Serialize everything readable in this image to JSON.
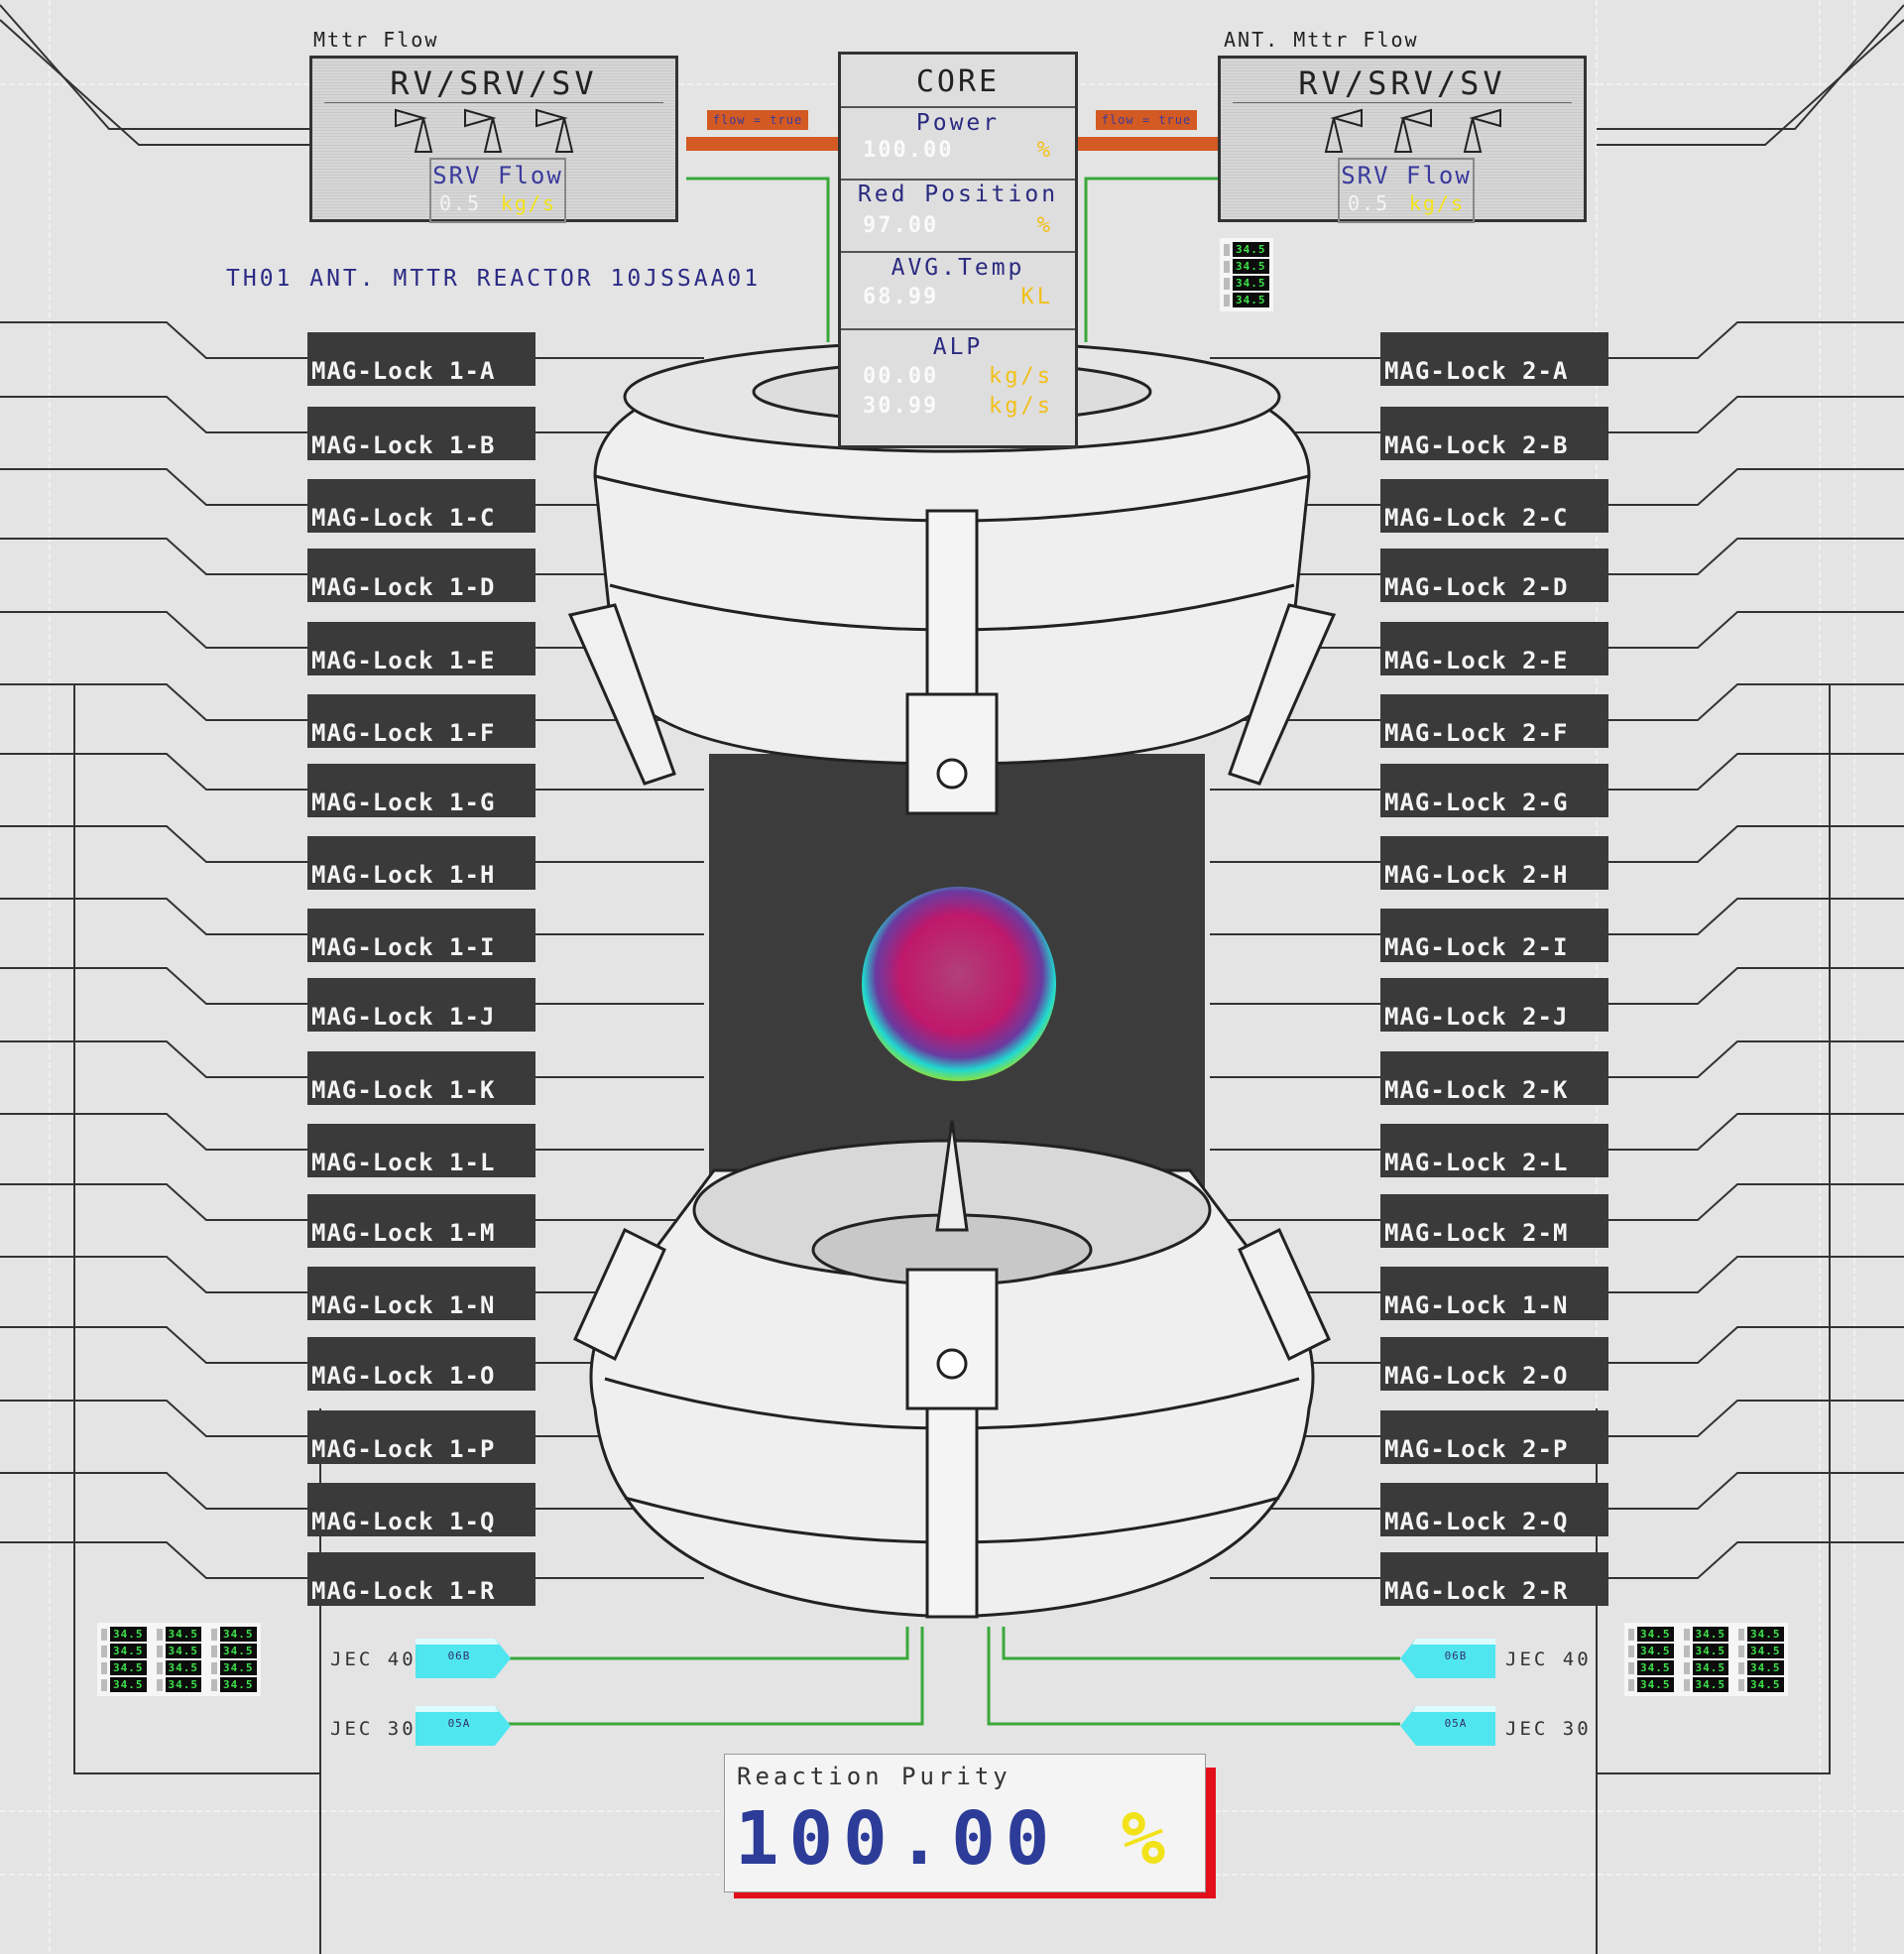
{
  "reactor_id": "TH01 ANT. MTTR REACTOR 10JSSAA01",
  "left_flow_panel": {
    "label": "Mttr Flow",
    "title": "RV/SRV/SV",
    "srv_title": "SRV Flow",
    "srv_value": "0.5",
    "srv_unit": "kg/s",
    "flow_tag": "flow = true"
  },
  "right_flow_panel": {
    "label": "ANT. Mttr Flow",
    "title": "RV/SRV/SV",
    "srv_title": "SRV Flow",
    "srv_value": "0.5",
    "srv_unit": "kg/s",
    "flow_tag": "flow = true"
  },
  "core": {
    "title": "CORE",
    "power": {
      "label": "Power",
      "value": "100.00",
      "unit": "%"
    },
    "red_position": {
      "label": "Red Position",
      "value": "97.00",
      "unit": "%"
    },
    "avg_temp": {
      "label": "AVG.Temp",
      "value": "68.99",
      "unit": "KL"
    },
    "alp": {
      "label": "ALP",
      "value1": "00.00",
      "unit1": "kg/s",
      "value2": "30.99",
      "unit2": "kg/s"
    }
  },
  "mag_locks_left": [
    "MAG-Lock 1-A",
    "MAG-Lock 1-B",
    "MAG-Lock 1-C",
    "MAG-Lock 1-D",
    "MAG-Lock 1-E",
    "MAG-Lock 1-F",
    "MAG-Lock 1-G",
    "MAG-Lock 1-H",
    "MAG-Lock 1-I",
    "MAG-Lock 1-J",
    "MAG-Lock 1-K",
    "MAG-Lock 1-L",
    "MAG-Lock 1-M",
    "MAG-Lock 1-N",
    "MAG-Lock 1-O",
    "MAG-Lock 1-P",
    "MAG-Lock 1-Q",
    "MAG-Lock 1-R"
  ],
  "mag_locks_right": [
    "MAG-Lock 2-A",
    "MAG-Lock 2-B",
    "MAG-Lock 2-C",
    "MAG-Lock 2-D",
    "MAG-Lock 2-E",
    "MAG-Lock 2-F",
    "MAG-Lock 2-G",
    "MAG-Lock 2-H",
    "MAG-Lock 2-I",
    "MAG-Lock 2-J",
    "MAG-Lock 2-K",
    "MAG-Lock 2-L",
    "MAG-Lock 2-M",
    "MAG-Lock 1-N",
    "MAG-Lock 2-O",
    "MAG-Lock 2-P",
    "MAG-Lock 2-Q",
    "MAG-Lock 2-R"
  ],
  "lcd_reading": "34.5",
  "jec_left": [
    {
      "label": "JEC 40",
      "tag": "06B"
    },
    {
      "label": "JEC 30",
      "tag": "05A"
    }
  ],
  "jec_right": [
    {
      "label": "JEC 40",
      "tag": "06B"
    },
    {
      "label": "JEC 30",
      "tag": "05A"
    }
  ],
  "reaction_purity": {
    "label": "Reaction Purity",
    "value": "100.00",
    "unit": "%"
  },
  "colors": {
    "accent_blue": "#2c3c98",
    "value_yellow": "#f2e21a",
    "flow_orange": "#d35a22",
    "line_green": "#3aa83a",
    "alert_red": "#e3101a",
    "lcd_green": "#3ee04a",
    "jec_cyan": "#4fe6f0"
  }
}
